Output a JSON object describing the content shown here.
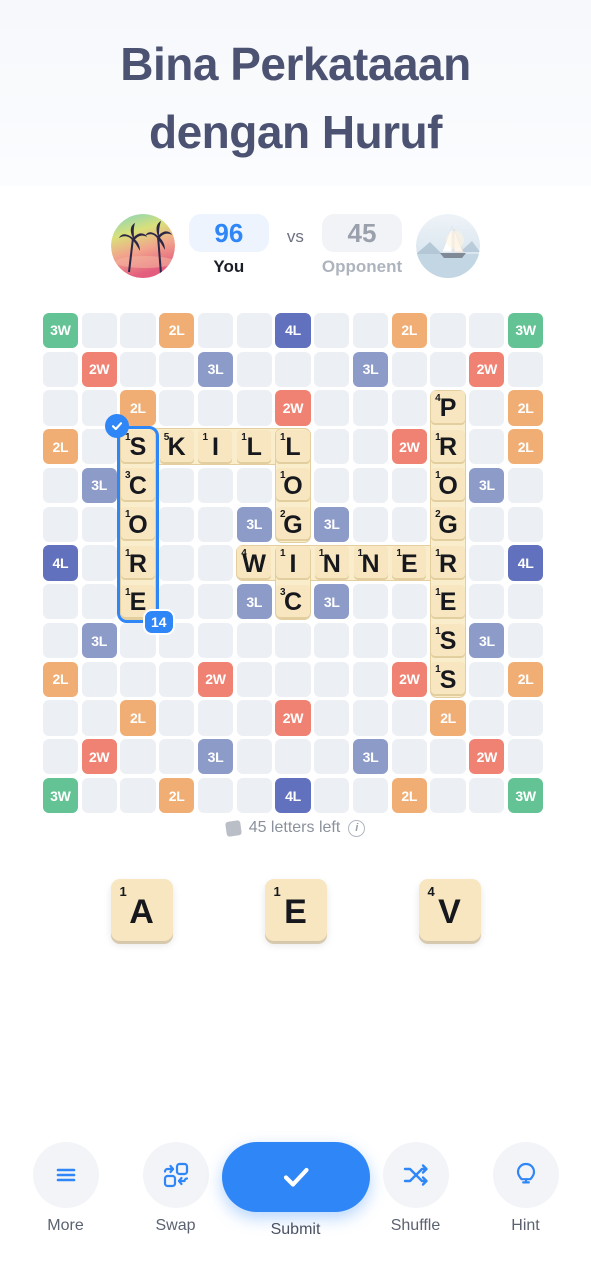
{
  "header": {
    "title_line1": "Bina Perkataaan",
    "title_line2": "dengan Huruf"
  },
  "scorebar": {
    "you": {
      "score": "96",
      "label": "You",
      "avatar_icon": "palm-sunset-avatar"
    },
    "vs": "vs",
    "opponent": {
      "score": "45",
      "label": "Opponent",
      "avatar_icon": "sailboat-avatar"
    }
  },
  "board": {
    "columns": 13,
    "rows": 13,
    "bonus_legend": {
      "3W": "triple-word",
      "2W": "double-word",
      "2L": "double-letter",
      "3L": "triple-letter",
      "4L": "quadruple-letter"
    },
    "bonus_colors": {
      "3W": "#63c395",
      "2W": "#ef8272",
      "2L": "#f0ae74",
      "3L": "#8d9bc9",
      "4L": "#6271bd"
    },
    "bonus_grid": [
      [
        "3W",
        "",
        "",
        "2L",
        "",
        "",
        "4L",
        "",
        "",
        "2L",
        "",
        "",
        "3W"
      ],
      [
        "",
        "2W",
        "",
        "",
        "3L",
        "",
        "",
        "",
        "3L",
        "",
        "",
        "2W",
        ""
      ],
      [
        "",
        "",
        "2L",
        "",
        "",
        "",
        "2W",
        "",
        "",
        "",
        "",
        "",
        "2L"
      ],
      [
        "2L",
        "",
        "",
        "",
        "",
        "",
        "",
        "",
        "",
        "2W",
        "",
        "",
        "2L"
      ],
      [
        "",
        "3L",
        "",
        "",
        "",
        "",
        "",
        "",
        "",
        "",
        "",
        "3L",
        ""
      ],
      [
        "",
        "",
        "",
        "",
        "",
        "3L",
        "",
        "3L",
        "",
        "",
        "",
        "",
        ""
      ],
      [
        "4L",
        "",
        "",
        "",
        "",
        "",
        "",
        "",
        "",
        "",
        "",
        "",
        "4L"
      ],
      [
        "",
        "",
        "",
        "",
        "",
        "3L",
        "",
        "3L",
        "",
        "",
        "",
        "",
        ""
      ],
      [
        "",
        "3L",
        "",
        "",
        "",
        "",
        "",
        "",
        "",
        "",
        "",
        "3L",
        ""
      ],
      [
        "2L",
        "",
        "",
        "",
        "2W",
        "",
        "",
        "",
        "",
        "2W",
        "",
        "",
        "2L"
      ],
      [
        "",
        "",
        "2L",
        "",
        "",
        "",
        "2W",
        "",
        "",
        "",
        "2L",
        "",
        ""
      ],
      [
        "",
        "2W",
        "",
        "",
        "3L",
        "",
        "",
        "",
        "3L",
        "",
        "",
        "2W",
        ""
      ],
      [
        "3W",
        "",
        "",
        "2L",
        "",
        "",
        "4L",
        "",
        "",
        "2L",
        "",
        "",
        "3W"
      ]
    ],
    "placed_words": [
      {
        "word": "SKILL",
        "direction": "across",
        "row": 3,
        "col": 2,
        "letters": [
          {
            "ch": "S",
            "pts": "1"
          },
          {
            "ch": "K",
            "pts": "5"
          },
          {
            "ch": "I",
            "pts": "1"
          },
          {
            "ch": "L",
            "pts": "1"
          },
          {
            "ch": "L",
            "pts": "1"
          }
        ]
      },
      {
        "word": "SCORE",
        "direction": "down",
        "row": 3,
        "col": 2,
        "selected": true,
        "score_badge": "14",
        "letters": [
          {
            "ch": "S",
            "pts": "1"
          },
          {
            "ch": "C",
            "pts": "3"
          },
          {
            "ch": "O",
            "pts": "1"
          },
          {
            "ch": "R",
            "pts": "1"
          },
          {
            "ch": "E",
            "pts": "1"
          }
        ]
      },
      {
        "word": "LOG",
        "direction": "down",
        "row": 3,
        "col": 6,
        "letters": [
          {
            "ch": "L",
            "pts": "1"
          },
          {
            "ch": "O",
            "pts": "1"
          },
          {
            "ch": "G",
            "pts": "2"
          }
        ]
      },
      {
        "word": "WINNER",
        "direction": "across",
        "row": 6,
        "col": 5,
        "letters": [
          {
            "ch": "W",
            "pts": "4"
          },
          {
            "ch": "I",
            "pts": "1"
          },
          {
            "ch": "N",
            "pts": "1"
          },
          {
            "ch": "N",
            "pts": "1"
          },
          {
            "ch": "E",
            "pts": "1"
          },
          {
            "ch": "R",
            "pts": "1"
          }
        ]
      },
      {
        "word": "IC",
        "direction": "down",
        "row": 6,
        "col": 6,
        "letters": [
          {
            "ch": "I",
            "pts": "1"
          },
          {
            "ch": "C",
            "pts": "3"
          }
        ]
      },
      {
        "word": "PROGRESS",
        "direction": "down",
        "row": 2,
        "col": 10,
        "letters": [
          {
            "ch": "P",
            "pts": "4"
          },
          {
            "ch": "R",
            "pts": "1"
          },
          {
            "ch": "O",
            "pts": "1"
          },
          {
            "ch": "G",
            "pts": "2"
          },
          {
            "ch": "R",
            "pts": "1"
          },
          {
            "ch": "E",
            "pts": "1"
          },
          {
            "ch": "S",
            "pts": "1"
          },
          {
            "ch": "S",
            "pts": "1"
          }
        ]
      }
    ]
  },
  "letters_left": {
    "count_text": "45 letters left",
    "bag_icon": "tile-bag-icon",
    "info_icon": "info-icon"
  },
  "rack": [
    {
      "ch": "A",
      "pts": "1"
    },
    {
      "ch": "E",
      "pts": "1"
    },
    {
      "ch": "V",
      "pts": "4"
    }
  ],
  "toolbar": {
    "more": {
      "label": "More",
      "icon": "hamburger-menu-icon"
    },
    "swap": {
      "label": "Swap",
      "icon": "swap-tiles-icon"
    },
    "submit": {
      "label": "Submit",
      "icon": "checkmark-icon",
      "color": "#2f86f6"
    },
    "shuffle": {
      "label": "Shuffle",
      "icon": "shuffle-icon"
    },
    "hint": {
      "label": "Hint",
      "icon": "lightbulb-icon"
    }
  }
}
